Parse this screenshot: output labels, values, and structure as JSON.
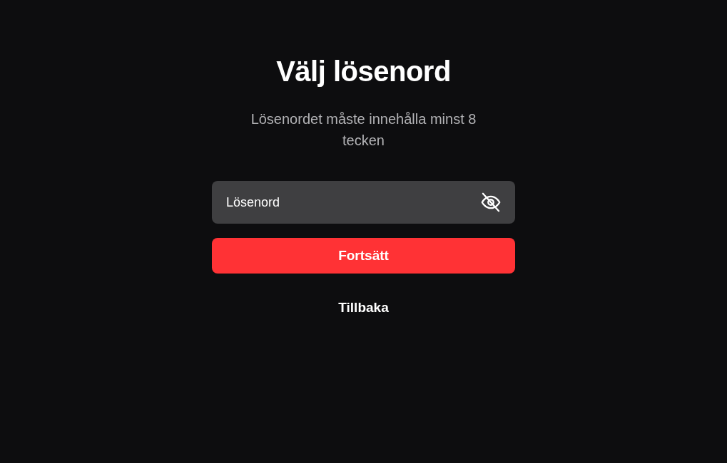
{
  "title": "Välj lösenord",
  "subtitle": "Lösenordet måste innehålla minst 8 tecken",
  "password_field": {
    "placeholder": "Lösenord",
    "revealed": false
  },
  "buttons": [
    {
      "kind": "primary",
      "label": "Fortsätt"
    },
    {
      "kind": "link",
      "label": "Tillbaka"
    }
  ]
}
